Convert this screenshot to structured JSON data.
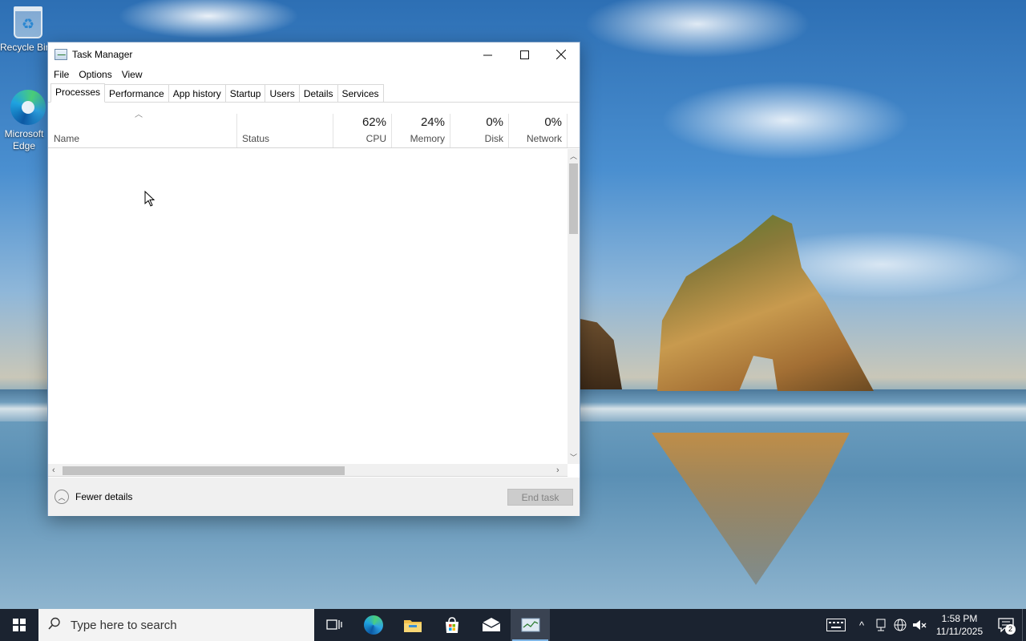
{
  "desktop": {
    "icons": [
      {
        "label": "Recycle Bin",
        "icon": "recycle-bin-icon"
      },
      {
        "label": "Microsoft Edge",
        "icon": "edge-icon"
      }
    ]
  },
  "window": {
    "title": "Task Manager",
    "menu": [
      "File",
      "Options",
      "View"
    ],
    "tabs": [
      "Processes",
      "Performance",
      "App history",
      "Startup",
      "Users",
      "Details",
      "Services"
    ],
    "active_tab": "Processes",
    "columns": {
      "name": "Name",
      "status": "Status",
      "cpu": {
        "label": "CPU",
        "value": "62%"
      },
      "memory": {
        "label": "Memory",
        "value": "24%"
      },
      "disk": {
        "label": "Disk",
        "value": "0%"
      },
      "network": {
        "label": "Network",
        "value": "0%"
      }
    },
    "footer": {
      "fewer_details": "Fewer details",
      "end_task": "End task"
    }
  },
  "taskbar": {
    "search_placeholder": "Type here to search",
    "pinned": [
      "task-view-icon",
      "edge-icon",
      "file-explorer-icon",
      "store-icon",
      "mail-icon",
      "task-manager-icon"
    ],
    "clock": {
      "time": "1:58 PM",
      "date": "11/11/2025"
    },
    "notification_count": "2",
    "accent": "#7fb6e6",
    "background": "#1b2330"
  }
}
